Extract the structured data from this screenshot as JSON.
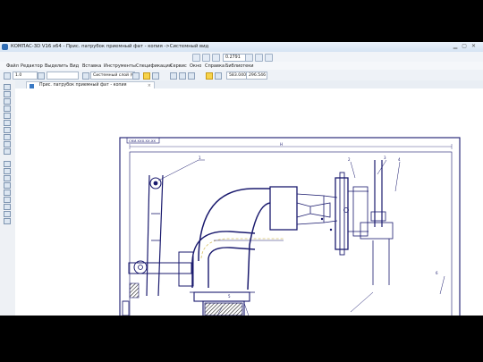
{
  "window": {
    "title": "КОМПАС-3D V16 x64 - Прис. патрубок приемный фат - копия ->Системный вид"
  },
  "toolbar": {
    "zoom_value": "0.2791"
  },
  "menu": {
    "items": [
      "Файл",
      "Редактор",
      "Выделить",
      "Вид",
      "Вставка",
      "Инструменты",
      "Спецификация",
      "Сервис",
      "Окно",
      "Справка",
      "Библиотеки"
    ]
  },
  "properties": {
    "line_scale": "1.0",
    "layer": "Системный слой (0)",
    "coord_x": "583.040",
    "coord_y": "296.546"
  },
  "document_tab": {
    "label": "Прис. патрубок приемный фат - копия"
  },
  "drawing": {
    "stamp_text": "СКИ.ХХХ.ХХ.ХХ",
    "callouts": [
      "1",
      "2",
      "3",
      "4",
      "5",
      "6"
    ],
    "dimension": "Н"
  },
  "colors": {
    "drawing_line": "#1a1a6e",
    "highlight_line": "#d9c36a",
    "hatch": "#222222",
    "title_gradient": "#d6e4f3"
  }
}
